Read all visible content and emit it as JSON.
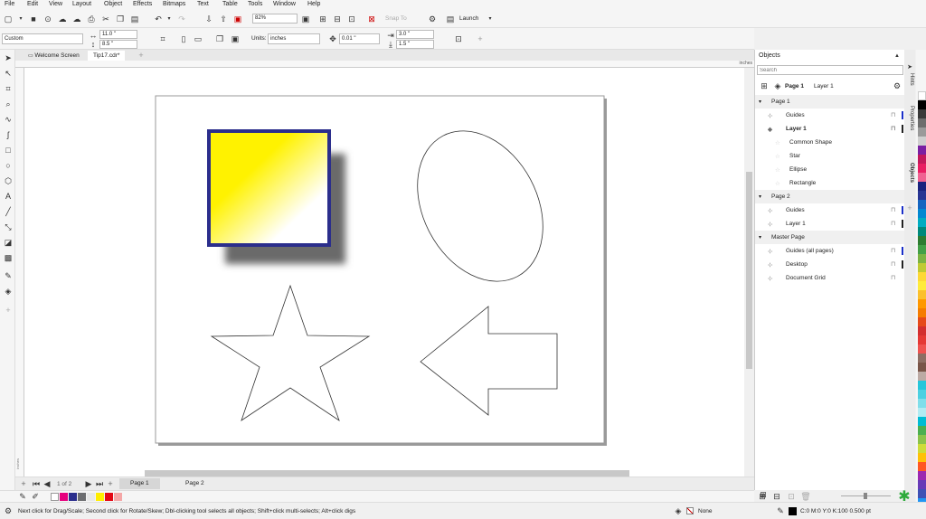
{
  "menu": [
    "File",
    "Edit",
    "View",
    "Layout",
    "Object",
    "Effects",
    "Bitmaps",
    "Text",
    "Table",
    "Tools",
    "Window",
    "Help"
  ],
  "toolbar": {
    "zoom": "82%",
    "snap_to": "Snap To",
    "launch": "Launch"
  },
  "propbar": {
    "preset": "Custom",
    "width": "11.0 \"",
    "height": "8.5 \"",
    "units_label": "Units:",
    "units": "inches",
    "nudge": "0.01 \"",
    "dup_x": "3.0 \"",
    "dup_y": "1.5 \""
  },
  "tabs": [
    "Welcome Screen",
    "Tip17.cdr*"
  ],
  "ruler": {
    "unit": "inches",
    "v_label": "inches"
  },
  "pagebar": {
    "counter": "1 of 2",
    "pages": [
      "Page 1",
      "Page 2"
    ]
  },
  "objects_panel": {
    "title": "Objects",
    "search_placeholder": "Search",
    "header_page": "Page 1",
    "header_layer": "Layer 1",
    "rows": [
      {
        "kind": "page",
        "text": "Page 1"
      },
      {
        "kind": "item",
        "text": "Guides",
        "color": "#1a2fc8"
      },
      {
        "kind": "layer",
        "text": "Layer 1",
        "color": "#222222"
      },
      {
        "kind": "obj",
        "text": "Common Shape"
      },
      {
        "kind": "obj",
        "text": "Star"
      },
      {
        "kind": "obj",
        "text": "Ellipse"
      },
      {
        "kind": "obj",
        "text": "Rectangle"
      },
      {
        "kind": "page",
        "text": "Page 2"
      },
      {
        "kind": "item",
        "text": "Guides",
        "color": "#1a2fc8"
      },
      {
        "kind": "item",
        "text": "Layer 1",
        "color": "#222222"
      },
      {
        "kind": "page",
        "text": "Master Page"
      },
      {
        "kind": "item",
        "text": "Guides (all pages)",
        "color": "#1a2fc8"
      },
      {
        "kind": "item",
        "text": "Desktop",
        "color": "#222222"
      },
      {
        "kind": "item",
        "text": "Document Grid",
        "color": ""
      }
    ]
  },
  "side_tabs": [
    "Hints",
    "Properties",
    "Objects"
  ],
  "doc_palette": [
    "#ffffff",
    "#e6007e",
    "#2b2e8c",
    "#6d6e71",
    "#e8e8e8",
    "#ffed00",
    "#e30613",
    "#f4a6a6"
  ],
  "color_palette": [
    "#ffffff",
    "#000000",
    "#3a3a3a",
    "#6d6d6d",
    "#9a9a9a",
    "#cfcfcf",
    "#7a1fa2",
    "#c2185b",
    "#e91e63",
    "#f06292",
    "#1a237e",
    "#283593",
    "#1565c0",
    "#0288d1",
    "#00acc1",
    "#00897b",
    "#2e7d32",
    "#43a047",
    "#7cb342",
    "#c0ca33",
    "#fdd835",
    "#ffeb3b",
    "#fbc02d",
    "#ff9800",
    "#f57c00",
    "#e64a19",
    "#d32f2f",
    "#e53935",
    "#ef5350",
    "#8d6e63",
    "#795548",
    "#bcaaa4",
    "#26c6da",
    "#4dd0e1",
    "#80deea",
    "#b2ebf2",
    "#00bcd4",
    "#4caf50",
    "#8bc34a",
    "#cddc39",
    "#ffc107",
    "#ff5722",
    "#9c27b0",
    "#673ab7",
    "#3f51b5",
    "#2196f3",
    "#03a9f4",
    "#009688",
    "#607d8b"
  ],
  "status": {
    "hint": "Next click for Drag/Scale; Second click for Rotate/Skew; Dbl-clicking tool selects all objects; Shift+click multi-selects; Alt+click digs",
    "fill": "None",
    "outline": "C:0 M:0 Y:0 K:100  0.500 pt"
  }
}
